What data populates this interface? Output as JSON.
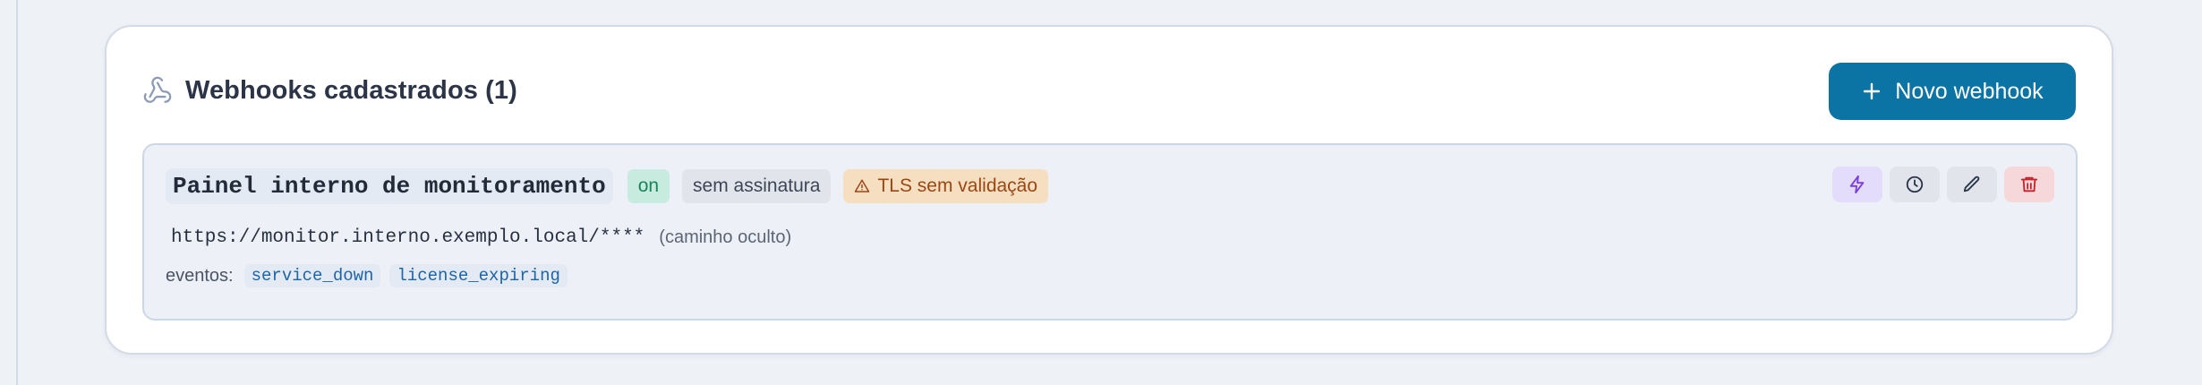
{
  "header": {
    "title": "Webhooks cadastrados (1)",
    "title_icon": "webhook-icon",
    "new_button_label": "Novo webhook",
    "new_button_icon": "plus-icon"
  },
  "webhooks": [
    {
      "name": "Painel interno de monitoramento",
      "status_badge": "on",
      "signature_badge": "sem assinatura",
      "tls_badge": "TLS sem validação",
      "tls_icon": "warning-triangle-icon",
      "url": "https://monitor.interno.exemplo.local/****",
      "url_hint": "(caminho oculto)",
      "events_label": "eventos:",
      "events": [
        "service_down",
        "license_expiring"
      ],
      "actions": [
        "zap-icon",
        "clock-icon",
        "pencil-icon",
        "trash-icon"
      ]
    }
  ],
  "colors": {
    "primary": "#0b74a5",
    "on_badge_bg": "#c8ebdf",
    "tls_badge_bg": "#f6dfc0",
    "test_action_bg": "#e4dcfb",
    "delete_action_bg": "#f6d8da"
  }
}
